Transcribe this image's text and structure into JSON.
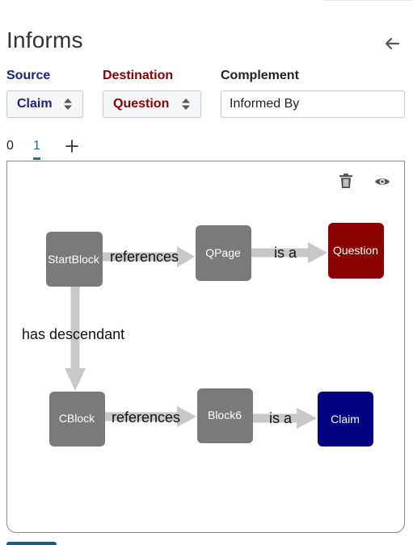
{
  "header": {
    "title": "Informs"
  },
  "fields": {
    "source_label": "Source",
    "source_value": "Claim",
    "destination_label": "Destination",
    "destination_value": "Question",
    "complement_label": "Complement",
    "complement_value": "Informed By"
  },
  "tabs": [
    {
      "label": "0"
    },
    {
      "label": "1",
      "active": true
    }
  ],
  "graph": {
    "nodes": [
      {
        "id": "startblock",
        "label": "StartBlock"
      },
      {
        "id": "qpage",
        "label": "QPage"
      },
      {
        "id": "question",
        "label": "Question"
      },
      {
        "id": "cblock",
        "label": "CBlock"
      },
      {
        "id": "block6",
        "label": "Block6"
      },
      {
        "id": "claim",
        "label": "Claim"
      }
    ],
    "edges": [
      {
        "from": "startblock",
        "to": "qpage",
        "label": "references"
      },
      {
        "from": "qpage",
        "to": "question",
        "label": "is a"
      },
      {
        "from": "startblock",
        "to": "cblock",
        "label": "has descendant"
      },
      {
        "from": "cblock",
        "to": "block6",
        "label": "references"
      },
      {
        "from": "block6",
        "to": "claim",
        "label": "is a"
      }
    ]
  },
  "colors": {
    "source_accent": "#1a237e",
    "destination_accent": "#8b0000",
    "node_default": "#7a7a7a",
    "node_question": "#8b0000",
    "node_claim": "#000080",
    "edge": "#c8c8c8",
    "tab_active": "#1c6fa8"
  },
  "icons": {
    "back": "arrow-left-icon",
    "add_tab": "plus-icon",
    "delete": "trash-icon",
    "view": "eye-icon",
    "select_caret": "sort-caret-icon"
  }
}
